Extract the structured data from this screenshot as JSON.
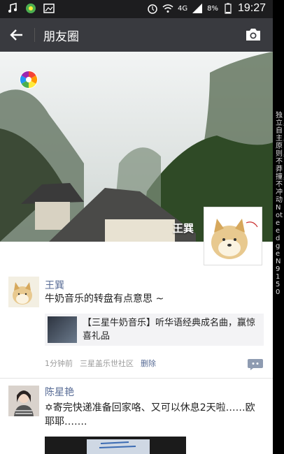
{
  "status_bar": {
    "time": "19:27",
    "battery": "8%",
    "network": "4G"
  },
  "action_bar": {
    "title": "朋友圈"
  },
  "cover": {
    "name": "王巽"
  },
  "posts": [
    {
      "name": "王巽",
      "text": "牛奶音乐的转盘有点意思 ~",
      "link_text": "【三星牛奶音乐】听华语经典成名曲，赢惊喜礼品",
      "time": "1分钟前",
      "source": "三星盖乐世社区",
      "delete": "删除"
    },
    {
      "name": "陈星艳",
      "text": "✡寄完快递准备回家咯、又可以休息2天啦……欧耶耶……."
    }
  ],
  "watermark": "独立，自主，原则，不莽撞，不冲动  Note edge N9150",
  "colors": {
    "action_bar": "#393a3f",
    "name_link": "#576b95",
    "status_bar": "#1d1d1f"
  }
}
